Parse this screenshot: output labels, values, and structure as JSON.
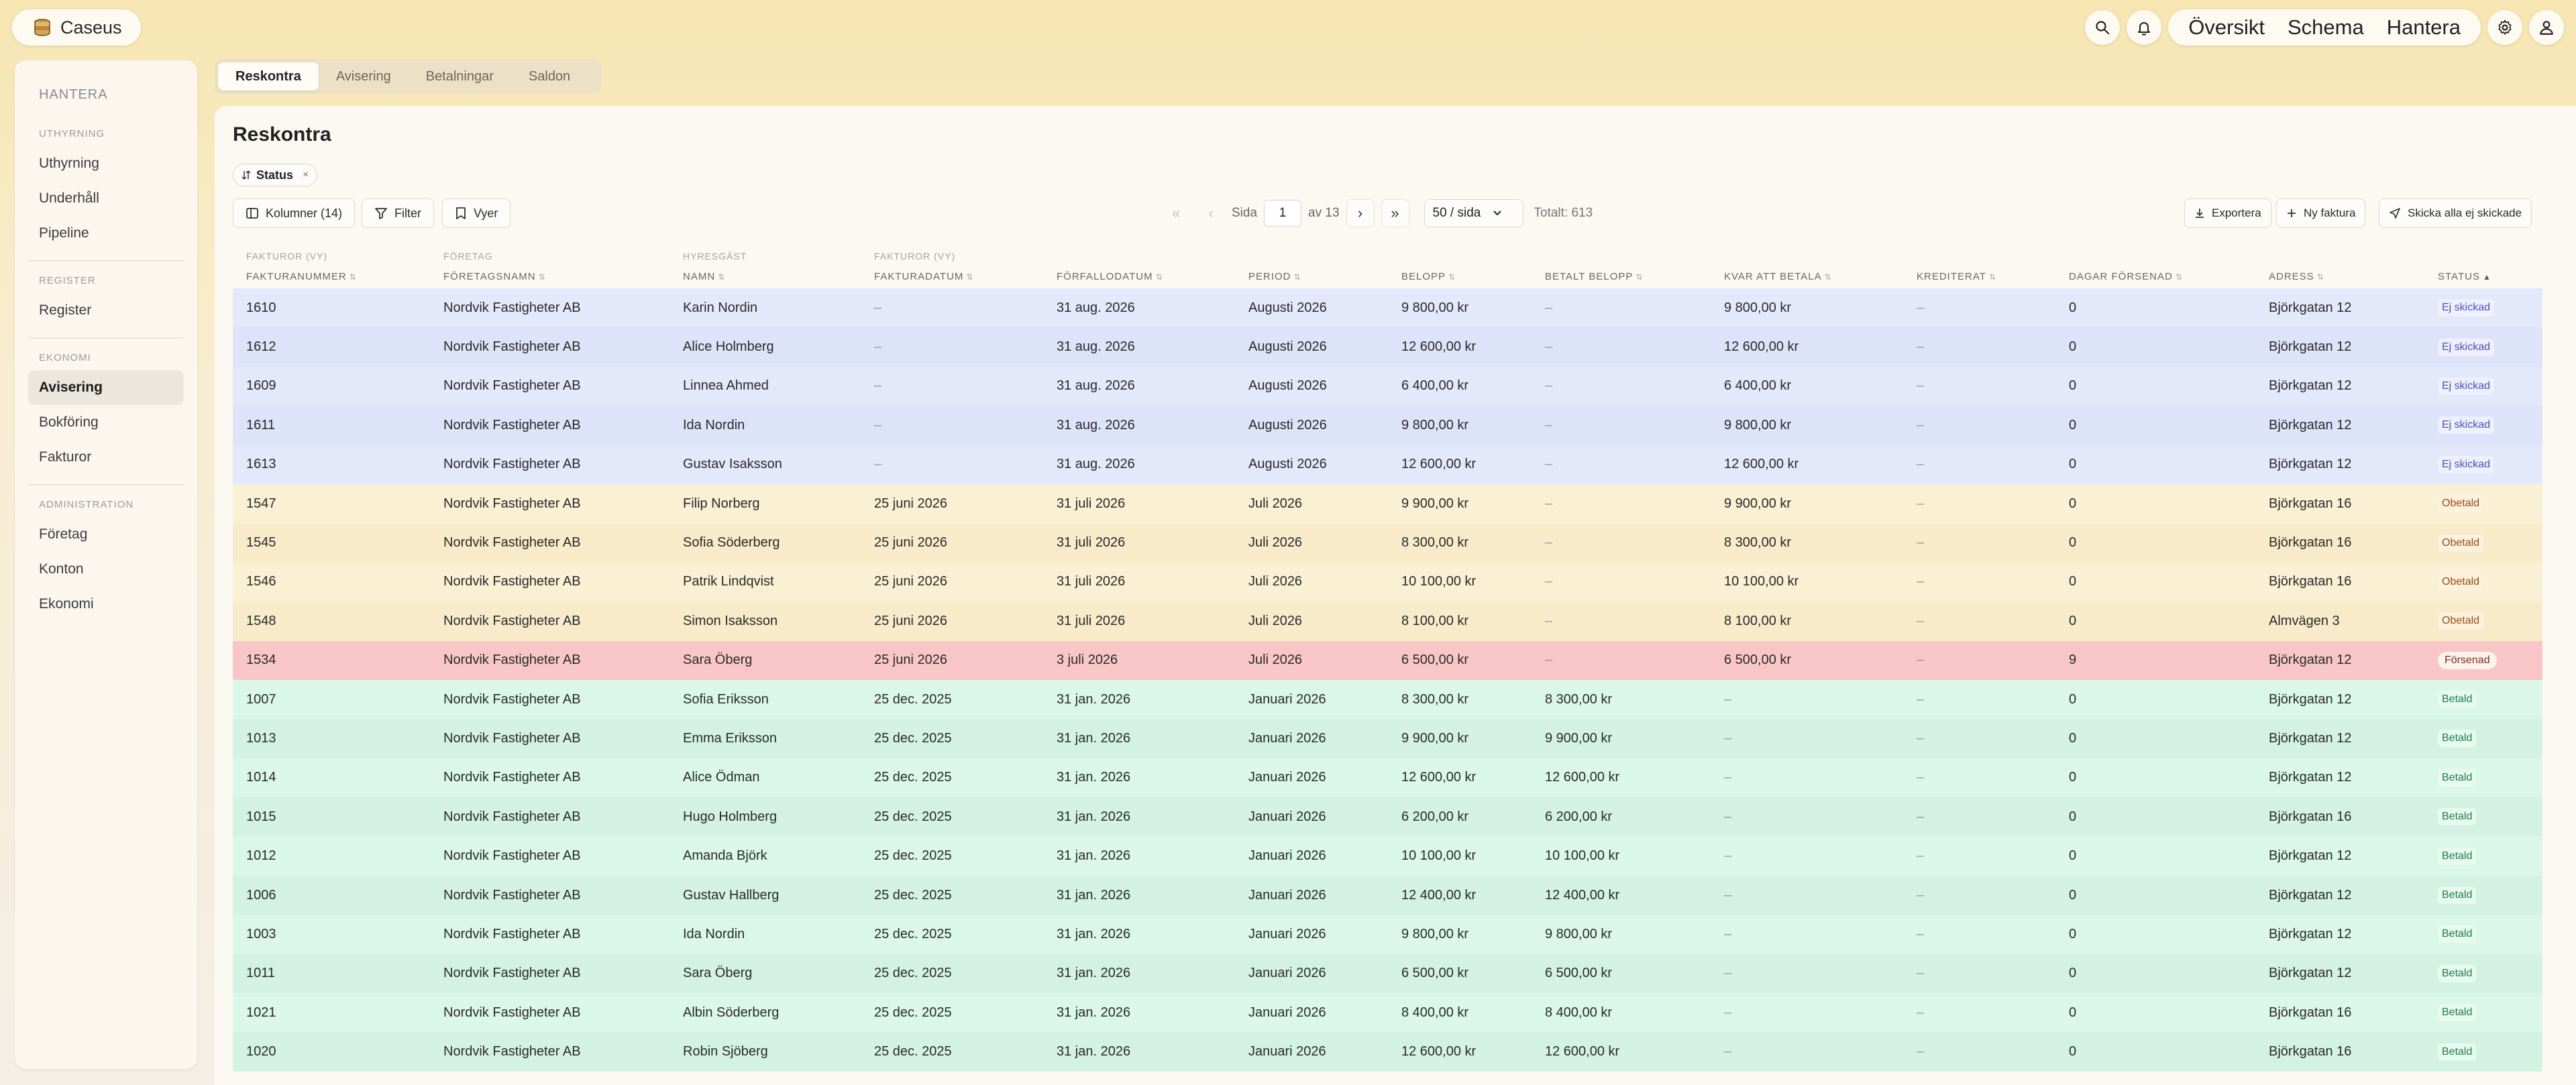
{
  "brand": {
    "name": "Caseus"
  },
  "topnav": {
    "items": [
      "Översikt",
      "Schema",
      "Hantera"
    ]
  },
  "sidebar": {
    "title": "HANTERA",
    "groups": [
      {
        "label": "UTHYRNING",
        "items": [
          {
            "label": "Uthyrning"
          },
          {
            "label": "Underhåll"
          },
          {
            "label": "Pipeline"
          }
        ]
      },
      {
        "label": "REGISTER",
        "items": [
          {
            "label": "Register"
          }
        ]
      },
      {
        "label": "EKONOMI",
        "items": [
          {
            "label": "Avisering"
          },
          {
            "label": "Bokföring"
          },
          {
            "label": "Fakturor"
          }
        ]
      },
      {
        "label": "ADMINISTRATION",
        "items": [
          {
            "label": "Företag"
          },
          {
            "label": "Konton"
          },
          {
            "label": "Ekonomi"
          }
        ]
      }
    ]
  },
  "tabs": [
    {
      "label": "Reskontra"
    },
    {
      "label": "Avisering"
    },
    {
      "label": "Betalningar"
    },
    {
      "label": "Saldon"
    }
  ],
  "page": {
    "title": "Reskontra",
    "filter_chip": "Status",
    "toolbar": {
      "columns": "Kolumner (14)",
      "filter": "Filter",
      "views": "Vyer"
    },
    "pager": {
      "page_label": "Sida",
      "page": "1",
      "of": "av 13",
      "per_page": "50 / sida",
      "total": "Totalt: 613"
    },
    "actions": {
      "export": "Exportera",
      "new_invoice": "Ny faktura",
      "send_all": "Skicka alla ej skickade"
    }
  },
  "table": {
    "group_headers": {
      "c0": "FAKTUROR (VY)",
      "c1": "FÖRETAG",
      "c2": "HYRESGÄST",
      "c3": "FAKTUROR (VY)"
    },
    "headers": [
      "FAKTURANUMMER",
      "FÖRETAGSNAMN",
      "NAMN",
      "FAKTURADATUM",
      "FÖRFALLODATUM",
      "PERIOD",
      "BELOPP",
      "BETALT BELOPP",
      "KVAR ATT BETALA",
      "KREDITERAT",
      "DAGAR FÖRSENAD",
      "ADRESS",
      "STATUS"
    ],
    "rows": [
      {
        "kind": "ej",
        "cells": [
          "1610",
          "Nordvik Fastigheter AB",
          "Karin Nordin",
          "–",
          "31 aug. 2026",
          "Augusti 2026",
          "9 800,00 kr",
          "–",
          "9 800,00 kr",
          "–",
          "0",
          "Björkgatan 12",
          "Ej skickad"
        ]
      },
      {
        "kind": "ej",
        "cells": [
          "1612",
          "Nordvik Fastigheter AB",
          "Alice Holmberg",
          "–",
          "31 aug. 2026",
          "Augusti 2026",
          "12 600,00 kr",
          "–",
          "12 600,00 kr",
          "–",
          "0",
          "Björkgatan 12",
          "Ej skickad"
        ]
      },
      {
        "kind": "ej",
        "cells": [
          "1609",
          "Nordvik Fastigheter AB",
          "Linnea Ahmed",
          "–",
          "31 aug. 2026",
          "Augusti 2026",
          "6 400,00 kr",
          "–",
          "6 400,00 kr",
          "–",
          "0",
          "Björkgatan 12",
          "Ej skickad"
        ]
      },
      {
        "kind": "ej",
        "cells": [
          "1611",
          "Nordvik Fastigheter AB",
          "Ida Nordin",
          "–",
          "31 aug. 2026",
          "Augusti 2026",
          "9 800,00 kr",
          "–",
          "9 800,00 kr",
          "–",
          "0",
          "Björkgatan 12",
          "Ej skickad"
        ]
      },
      {
        "kind": "ej",
        "cells": [
          "1613",
          "Nordvik Fastigheter AB",
          "Gustav Isaksson",
          "–",
          "31 aug. 2026",
          "Augusti 2026",
          "12 600,00 kr",
          "–",
          "12 600,00 kr",
          "–",
          "0",
          "Björkgatan 12",
          "Ej skickad"
        ]
      },
      {
        "kind": "ob",
        "cells": [
          "1547",
          "Nordvik Fastigheter AB",
          "Filip Norberg",
          "25 juni 2026",
          "31 juli 2026",
          "Juli 2026",
          "9 900,00 kr",
          "–",
          "9 900,00 kr",
          "–",
          "0",
          "Björkgatan 16",
          "Obetald"
        ]
      },
      {
        "kind": "ob",
        "cells": [
          "1545",
          "Nordvik Fastigheter AB",
          "Sofia Söderberg",
          "25 juni 2026",
          "31 juli 2026",
          "Juli 2026",
          "8 300,00 kr",
          "–",
          "8 300,00 kr",
          "–",
          "0",
          "Björkgatan 16",
          "Obetald"
        ]
      },
      {
        "kind": "ob",
        "cells": [
          "1546",
          "Nordvik Fastigheter AB",
          "Patrik Lindqvist",
          "25 juni 2026",
          "31 juli 2026",
          "Juli 2026",
          "10 100,00 kr",
          "–",
          "10 100,00 kr",
          "–",
          "0",
          "Björkgatan 16",
          "Obetald"
        ]
      },
      {
        "kind": "ob",
        "cells": [
          "1548",
          "Nordvik Fastigheter AB",
          "Simon Isaksson",
          "25 juni 2026",
          "31 juli 2026",
          "Juli 2026",
          "8 100,00 kr",
          "–",
          "8 100,00 kr",
          "–",
          "0",
          "Almvägen 3",
          "Obetald"
        ]
      },
      {
        "kind": "fs",
        "cells": [
          "1534",
          "Nordvik Fastigheter AB",
          "Sara Öberg",
          "25 juni 2026",
          "3 juli 2026",
          "Juli 2026",
          "6 500,00 kr",
          "–",
          "6 500,00 kr",
          "–",
          "9",
          "Björkgatan 12",
          "Försenad"
        ]
      },
      {
        "kind": "bt",
        "cells": [
          "1007",
          "Nordvik Fastigheter AB",
          "Sofia Eriksson",
          "25 dec. 2025",
          "31 jan. 2026",
          "Januari 2026",
          "8 300,00 kr",
          "8 300,00 kr",
          "–",
          "–",
          "0",
          "Björkgatan 12",
          "Betald"
        ]
      },
      {
        "kind": "bt",
        "cells": [
          "1013",
          "Nordvik Fastigheter AB",
          "Emma Eriksson",
          "25 dec. 2025",
          "31 jan. 2026",
          "Januari 2026",
          "9 900,00 kr",
          "9 900,00 kr",
          "–",
          "–",
          "0",
          "Björkgatan 12",
          "Betald"
        ]
      },
      {
        "kind": "bt",
        "cells": [
          "1014",
          "Nordvik Fastigheter AB",
          "Alice Ödman",
          "25 dec. 2025",
          "31 jan. 2026",
          "Januari 2026",
          "12 600,00 kr",
          "12 600,00 kr",
          "–",
          "–",
          "0",
          "Björkgatan 12",
          "Betald"
        ]
      },
      {
        "kind": "bt",
        "cells": [
          "1015",
          "Nordvik Fastigheter AB",
          "Hugo Holmberg",
          "25 dec. 2025",
          "31 jan. 2026",
          "Januari 2026",
          "6 200,00 kr",
          "6 200,00 kr",
          "–",
          "–",
          "0",
          "Björkgatan 16",
          "Betald"
        ]
      },
      {
        "kind": "bt",
        "cells": [
          "1012",
          "Nordvik Fastigheter AB",
          "Amanda Björk",
          "25 dec. 2025",
          "31 jan. 2026",
          "Januari 2026",
          "10 100,00 kr",
          "10 100,00 kr",
          "–",
          "–",
          "0",
          "Björkgatan 12",
          "Betald"
        ]
      },
      {
        "kind": "bt",
        "cells": [
          "1006",
          "Nordvik Fastigheter AB",
          "Gustav Hallberg",
          "25 dec. 2025",
          "31 jan. 2026",
          "Januari 2026",
          "12 400,00 kr",
          "12 400,00 kr",
          "–",
          "–",
          "0",
          "Björkgatan 12",
          "Betald"
        ]
      },
      {
        "kind": "bt",
        "cells": [
          "1003",
          "Nordvik Fastigheter AB",
          "Ida Nordin",
          "25 dec. 2025",
          "31 jan. 2026",
          "Januari 2026",
          "9 800,00 kr",
          "9 800,00 kr",
          "–",
          "–",
          "0",
          "Björkgatan 12",
          "Betald"
        ]
      },
      {
        "kind": "bt",
        "cells": [
          "1011",
          "Nordvik Fastigheter AB",
          "Sara Öberg",
          "25 dec. 2025",
          "31 jan. 2026",
          "Januari 2026",
          "6 500,00 kr",
          "6 500,00 kr",
          "–",
          "–",
          "0",
          "Björkgatan 12",
          "Betald"
        ]
      },
      {
        "kind": "bt",
        "cells": [
          "1021",
          "Nordvik Fastigheter AB",
          "Albin Söderberg",
          "25 dec. 2025",
          "31 jan. 2026",
          "Januari 2026",
          "8 400,00 kr",
          "8 400,00 kr",
          "–",
          "–",
          "0",
          "Björkgatan 16",
          "Betald"
        ]
      },
      {
        "kind": "bt",
        "cells": [
          "1020",
          "Nordvik Fastigheter AB",
          "Robin Sjöberg",
          "25 dec. 2025",
          "31 jan. 2026",
          "Januari 2026",
          "12 600,00 kr",
          "12 600,00 kr",
          "–",
          "–",
          "0",
          "Björkgatan 16",
          "Betald"
        ]
      }
    ]
  },
  "icons": {
    "logo": "stack-icon",
    "search": "search-icon",
    "bell": "bell-icon",
    "settings": "gear-icon",
    "user": "user-icon",
    "columns": "columns-icon",
    "filter": "filter-icon",
    "views": "bookmark-icon",
    "export": "download-icon",
    "new": "plus-icon",
    "send": "send-icon"
  },
  "colors": {
    "ej_row": "#e3e8fb",
    "obetald_row": "#f7ebca",
    "forsenad_row": "#f8c6c7",
    "betald_row": "#daf7ea",
    "ej_badge": "#4b4fb8",
    "obetald_badge": "#9a4b1a",
    "forsenad_badge": "#7d2f20",
    "betald_badge": "#207a4e"
  }
}
